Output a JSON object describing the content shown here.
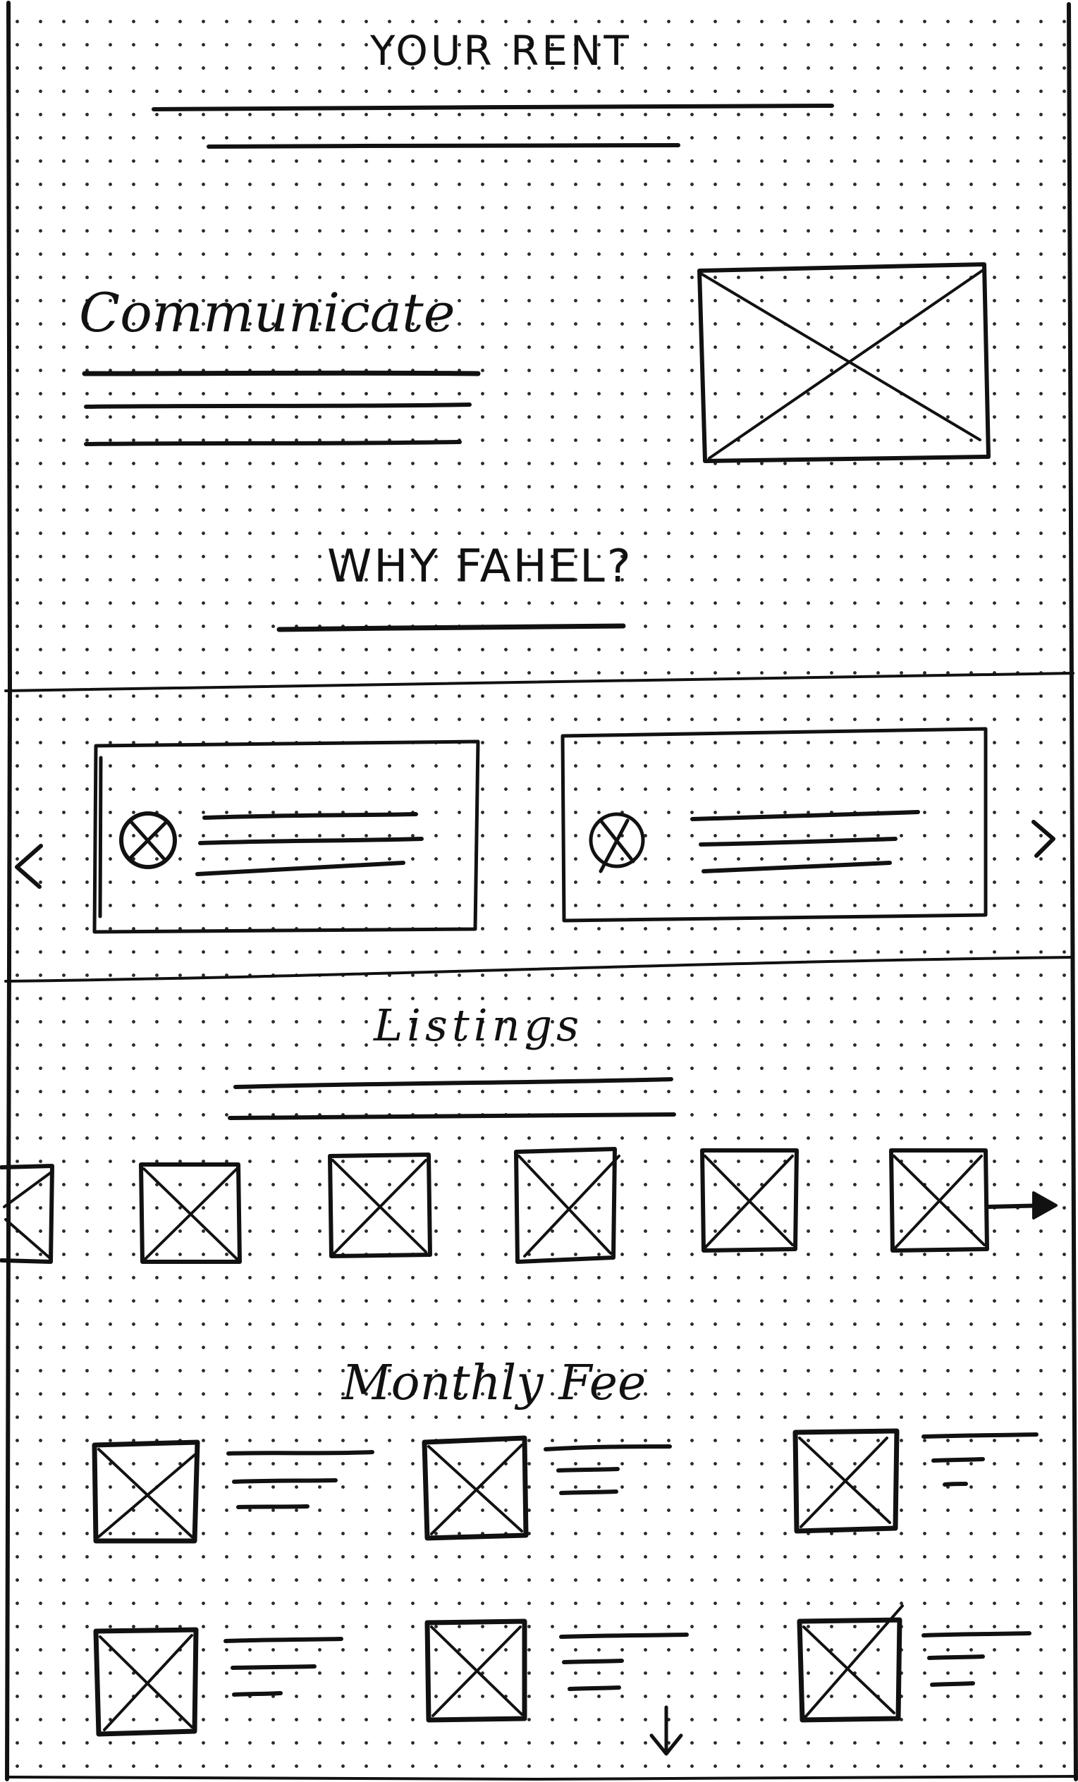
{
  "header": {
    "title": "YOUR RENT"
  },
  "intro": {
    "heading": "Communicate"
  },
  "why": {
    "heading": "WHY FAHEL?"
  },
  "listings": {
    "heading": "Listings"
  },
  "monthly": {
    "heading": "Monthly Fee"
  },
  "icons": {
    "prev": "chevron-left-icon",
    "next": "chevron-right-icon",
    "more": "arrow-right-icon",
    "scroll": "arrow-down-icon"
  }
}
